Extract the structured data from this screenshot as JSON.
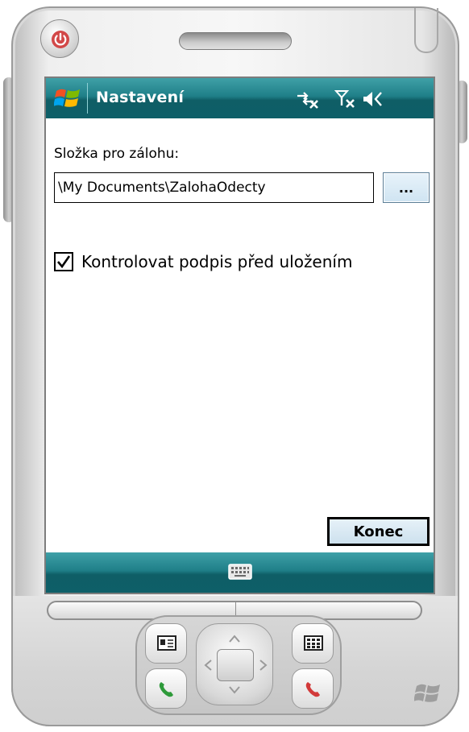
{
  "window": {
    "title": "Nastavení"
  },
  "form": {
    "folder_label": "Složka pro zálohu:",
    "folder_path": "\\My Documents\\ZalohaOdecty",
    "browse_label": "...",
    "verify_checkbox_label": "Kontrolovat podpis před uložením",
    "verify_checked": true,
    "close_label": "Konec"
  },
  "colors": {
    "titlebar": "#1f7f88",
    "screen_bg": "#ffffff",
    "button_face": "#cfe4f2"
  },
  "icons": {
    "start": "windows-start-icon",
    "connectivity": "connectivity-icon",
    "signal": "no-signal-icon",
    "volume": "volume-icon",
    "keyboard": "keyboard-icon"
  }
}
